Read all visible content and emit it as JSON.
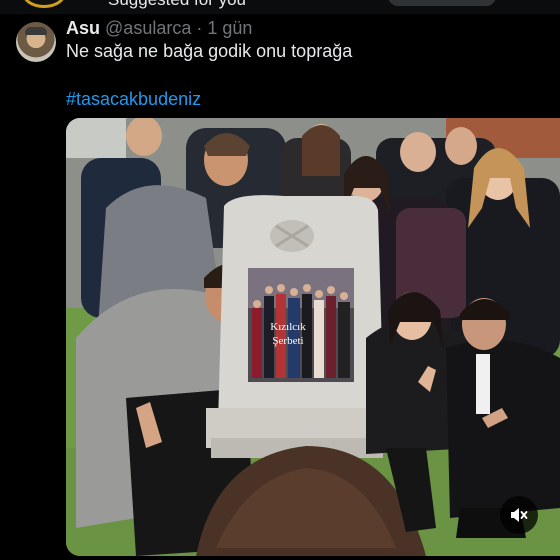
{
  "topbar": {
    "suggested_label": "Suggested for you"
  },
  "tweet": {
    "display_name": "Asu",
    "handle": "@asularca",
    "separator": "·",
    "time": "1 gün",
    "text": "Ne sağa ne bağa godik onu toprağa",
    "hashtag": "#tasacakbudeniz"
  },
  "media": {
    "poster_title_line1": "Kızılcık",
    "poster_title_line2": "Şerbeti",
    "icons": {
      "mute": "volume-muted-icon"
    }
  },
  "colors": {
    "background": "#000000",
    "text": "#e7e9ea",
    "secondary_text": "#71767b",
    "link": "#1d9bf0",
    "grass": "#6f9b47"
  }
}
